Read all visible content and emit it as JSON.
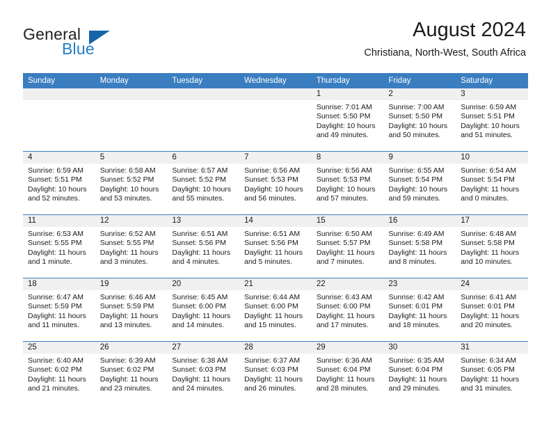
{
  "logo": {
    "word_top": "General",
    "word_bottom": "Blue",
    "accent_color": "#1565a8",
    "text_color": "#231f20",
    "blue_text_color": "#1f7fc4"
  },
  "header": {
    "title": "August 2024",
    "subtitle": "Christiana, North-West, South Africa",
    "header_bg_color": "#3a7ec0",
    "daynum_band_color": "#f0f0f0"
  },
  "day_headers": [
    "Sunday",
    "Monday",
    "Tuesday",
    "Wednesday",
    "Thursday",
    "Friday",
    "Saturday"
  ],
  "weeks": [
    [
      {
        "day": "",
        "sunrise": "",
        "sunset": "",
        "daylight": "",
        "empty": true
      },
      {
        "day": "",
        "sunrise": "",
        "sunset": "",
        "daylight": "",
        "empty": true
      },
      {
        "day": "",
        "sunrise": "",
        "sunset": "",
        "daylight": "",
        "empty": true
      },
      {
        "day": "",
        "sunrise": "",
        "sunset": "",
        "daylight": "",
        "empty": true
      },
      {
        "day": "1",
        "sunrise": "Sunrise: 7:01 AM",
        "sunset": "Sunset: 5:50 PM",
        "daylight": "Daylight: 10 hours and 49 minutes.",
        "empty": false
      },
      {
        "day": "2",
        "sunrise": "Sunrise: 7:00 AM",
        "sunset": "Sunset: 5:50 PM",
        "daylight": "Daylight: 10 hours and 50 minutes.",
        "empty": false
      },
      {
        "day": "3",
        "sunrise": "Sunrise: 6:59 AM",
        "sunset": "Sunset: 5:51 PM",
        "daylight": "Daylight: 10 hours and 51 minutes.",
        "empty": false
      }
    ],
    [
      {
        "day": "4",
        "sunrise": "Sunrise: 6:59 AM",
        "sunset": "Sunset: 5:51 PM",
        "daylight": "Daylight: 10 hours and 52 minutes.",
        "empty": false
      },
      {
        "day": "5",
        "sunrise": "Sunrise: 6:58 AM",
        "sunset": "Sunset: 5:52 PM",
        "daylight": "Daylight: 10 hours and 53 minutes.",
        "empty": false
      },
      {
        "day": "6",
        "sunrise": "Sunrise: 6:57 AM",
        "sunset": "Sunset: 5:52 PM",
        "daylight": "Daylight: 10 hours and 55 minutes.",
        "empty": false
      },
      {
        "day": "7",
        "sunrise": "Sunrise: 6:56 AM",
        "sunset": "Sunset: 5:53 PM",
        "daylight": "Daylight: 10 hours and 56 minutes.",
        "empty": false
      },
      {
        "day": "8",
        "sunrise": "Sunrise: 6:56 AM",
        "sunset": "Sunset: 5:53 PM",
        "daylight": "Daylight: 10 hours and 57 minutes.",
        "empty": false
      },
      {
        "day": "9",
        "sunrise": "Sunrise: 6:55 AM",
        "sunset": "Sunset: 5:54 PM",
        "daylight": "Daylight: 10 hours and 59 minutes.",
        "empty": false
      },
      {
        "day": "10",
        "sunrise": "Sunrise: 6:54 AM",
        "sunset": "Sunset: 5:54 PM",
        "daylight": "Daylight: 11 hours and 0 minutes.",
        "empty": false
      }
    ],
    [
      {
        "day": "11",
        "sunrise": "Sunrise: 6:53 AM",
        "sunset": "Sunset: 5:55 PM",
        "daylight": "Daylight: 11 hours and 1 minute.",
        "empty": false
      },
      {
        "day": "12",
        "sunrise": "Sunrise: 6:52 AM",
        "sunset": "Sunset: 5:55 PM",
        "daylight": "Daylight: 11 hours and 3 minutes.",
        "empty": false
      },
      {
        "day": "13",
        "sunrise": "Sunrise: 6:51 AM",
        "sunset": "Sunset: 5:56 PM",
        "daylight": "Daylight: 11 hours and 4 minutes.",
        "empty": false
      },
      {
        "day": "14",
        "sunrise": "Sunrise: 6:51 AM",
        "sunset": "Sunset: 5:56 PM",
        "daylight": "Daylight: 11 hours and 5 minutes.",
        "empty": false
      },
      {
        "day": "15",
        "sunrise": "Sunrise: 6:50 AM",
        "sunset": "Sunset: 5:57 PM",
        "daylight": "Daylight: 11 hours and 7 minutes.",
        "empty": false
      },
      {
        "day": "16",
        "sunrise": "Sunrise: 6:49 AM",
        "sunset": "Sunset: 5:58 PM",
        "daylight": "Daylight: 11 hours and 8 minutes.",
        "empty": false
      },
      {
        "day": "17",
        "sunrise": "Sunrise: 6:48 AM",
        "sunset": "Sunset: 5:58 PM",
        "daylight": "Daylight: 11 hours and 10 minutes.",
        "empty": false
      }
    ],
    [
      {
        "day": "18",
        "sunrise": "Sunrise: 6:47 AM",
        "sunset": "Sunset: 5:59 PM",
        "daylight": "Daylight: 11 hours and 11 minutes.",
        "empty": false
      },
      {
        "day": "19",
        "sunrise": "Sunrise: 6:46 AM",
        "sunset": "Sunset: 5:59 PM",
        "daylight": "Daylight: 11 hours and 13 minutes.",
        "empty": false
      },
      {
        "day": "20",
        "sunrise": "Sunrise: 6:45 AM",
        "sunset": "Sunset: 6:00 PM",
        "daylight": "Daylight: 11 hours and 14 minutes.",
        "empty": false
      },
      {
        "day": "21",
        "sunrise": "Sunrise: 6:44 AM",
        "sunset": "Sunset: 6:00 PM",
        "daylight": "Daylight: 11 hours and 15 minutes.",
        "empty": false
      },
      {
        "day": "22",
        "sunrise": "Sunrise: 6:43 AM",
        "sunset": "Sunset: 6:00 PM",
        "daylight": "Daylight: 11 hours and 17 minutes.",
        "empty": false
      },
      {
        "day": "23",
        "sunrise": "Sunrise: 6:42 AM",
        "sunset": "Sunset: 6:01 PM",
        "daylight": "Daylight: 11 hours and 18 minutes.",
        "empty": false
      },
      {
        "day": "24",
        "sunrise": "Sunrise: 6:41 AM",
        "sunset": "Sunset: 6:01 PM",
        "daylight": "Daylight: 11 hours and 20 minutes.",
        "empty": false
      }
    ],
    [
      {
        "day": "25",
        "sunrise": "Sunrise: 6:40 AM",
        "sunset": "Sunset: 6:02 PM",
        "daylight": "Daylight: 11 hours and 21 minutes.",
        "empty": false
      },
      {
        "day": "26",
        "sunrise": "Sunrise: 6:39 AM",
        "sunset": "Sunset: 6:02 PM",
        "daylight": "Daylight: 11 hours and 23 minutes.",
        "empty": false
      },
      {
        "day": "27",
        "sunrise": "Sunrise: 6:38 AM",
        "sunset": "Sunset: 6:03 PM",
        "daylight": "Daylight: 11 hours and 24 minutes.",
        "empty": false
      },
      {
        "day": "28",
        "sunrise": "Sunrise: 6:37 AM",
        "sunset": "Sunset: 6:03 PM",
        "daylight": "Daylight: 11 hours and 26 minutes.",
        "empty": false
      },
      {
        "day": "29",
        "sunrise": "Sunrise: 6:36 AM",
        "sunset": "Sunset: 6:04 PM",
        "daylight": "Daylight: 11 hours and 28 minutes.",
        "empty": false
      },
      {
        "day": "30",
        "sunrise": "Sunrise: 6:35 AM",
        "sunset": "Sunset: 6:04 PM",
        "daylight": "Daylight: 11 hours and 29 minutes.",
        "empty": false
      },
      {
        "day": "31",
        "sunrise": "Sunrise: 6:34 AM",
        "sunset": "Sunset: 6:05 PM",
        "daylight": "Daylight: 11 hours and 31 minutes.",
        "empty": false
      }
    ]
  ]
}
